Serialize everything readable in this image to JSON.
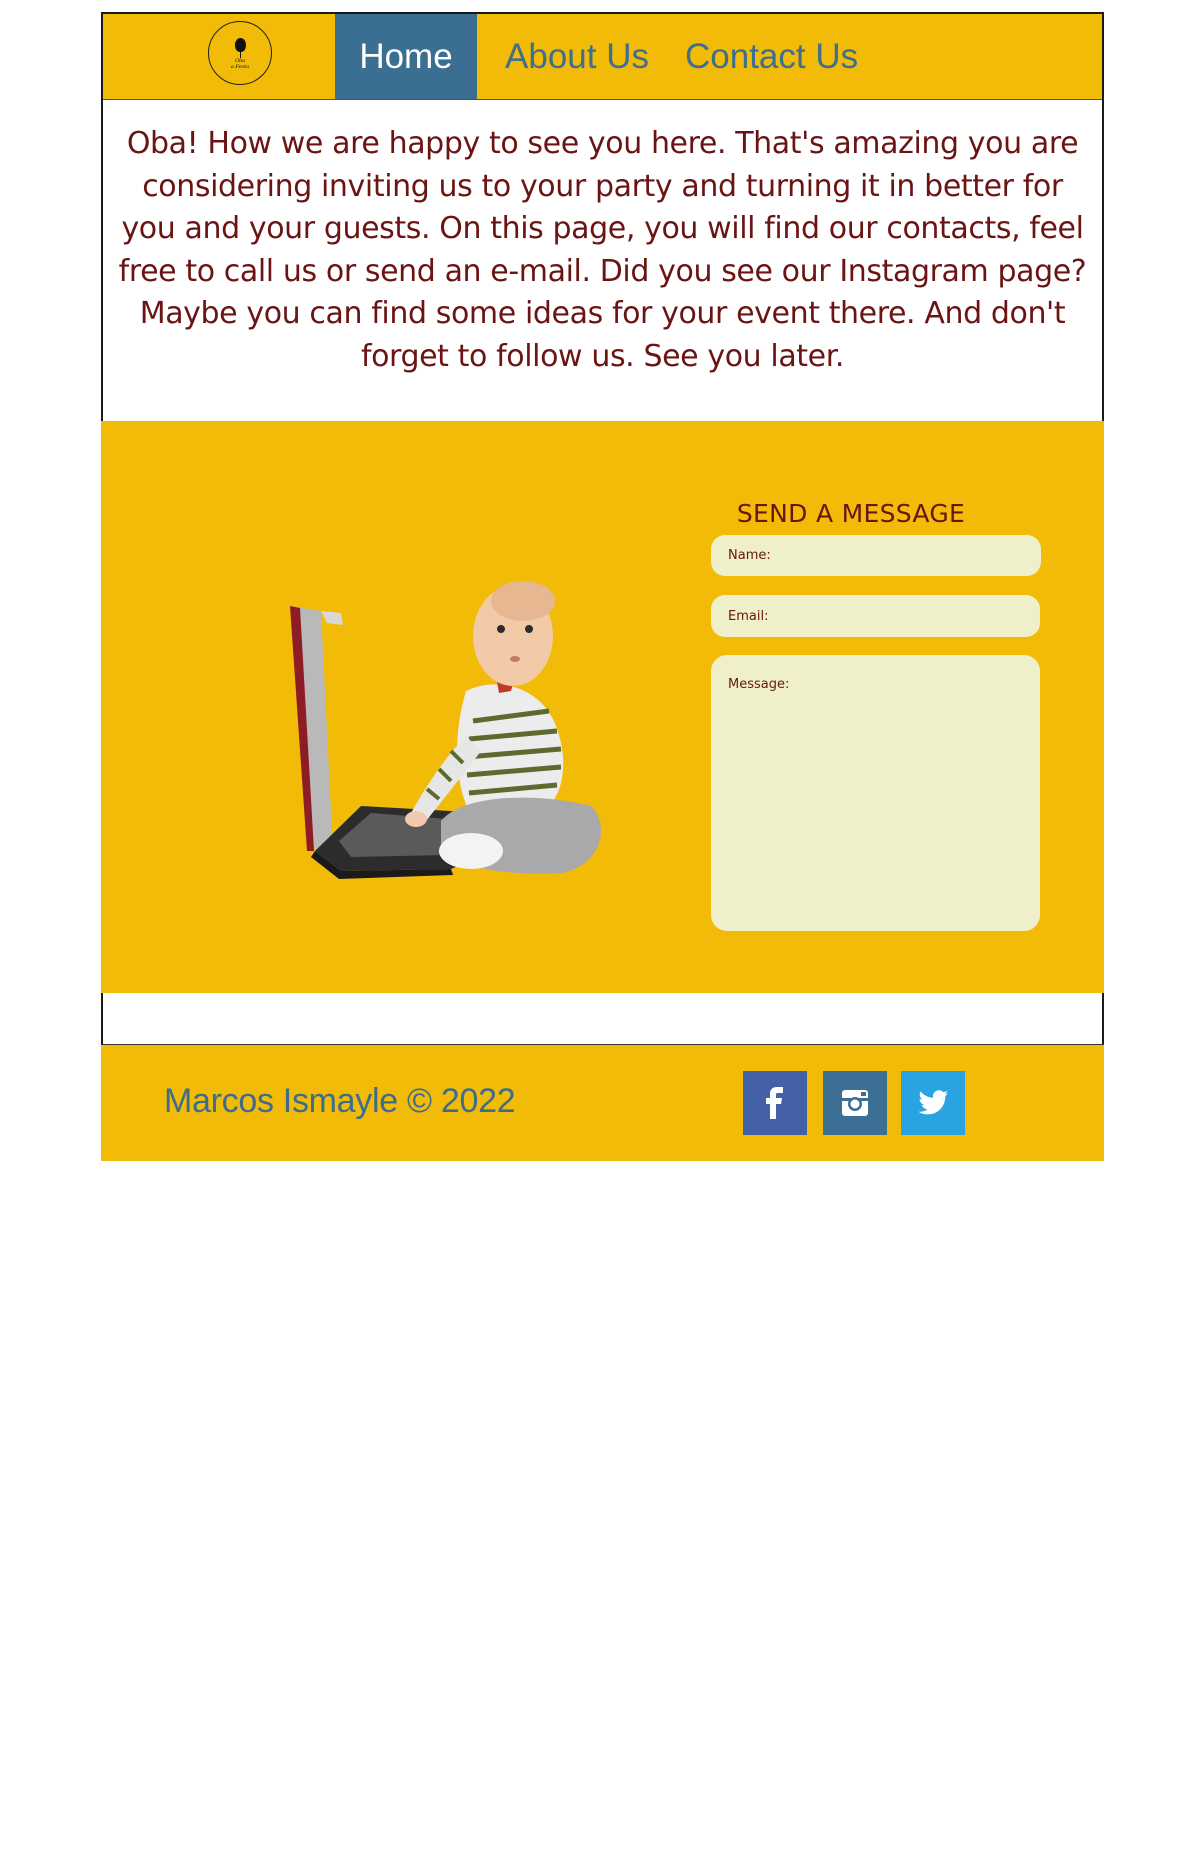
{
  "header": {
    "logo_text_line1": "Oba",
    "logo_text_line2": "a Festa",
    "nav": {
      "home": "Home",
      "about": "About Us",
      "contact": "Contact Us"
    }
  },
  "intro": {
    "text": "Oba! How we are happy to see you here. That's amazing you are considering inviting us to your party and turning it in better for you and your guests. On this page, you will find our contacts, feel free to call us or send an e-mail. Did you see our Instagram page? Maybe you can find some ideas for your event there. And don't forget to follow us. See you later."
  },
  "contact_form": {
    "title": "SEND A MESSAGE",
    "name_placeholder": "Name:",
    "email_placeholder": "Email:",
    "message_placeholder": "Message:"
  },
  "footer": {
    "copyright": "Marcos Ismayle © 2022",
    "social": [
      "facebook-icon",
      "instagram-icon",
      "twitter-icon"
    ]
  },
  "colors": {
    "brand_yellow": "#f1bb07",
    "nav_active": "#3a6f92",
    "text_maroon": "#6b1414",
    "field_bg": "#eff0c9",
    "facebook": "#4461a8",
    "instagram": "#3d6f94",
    "twitter": "#2aa4e0"
  }
}
